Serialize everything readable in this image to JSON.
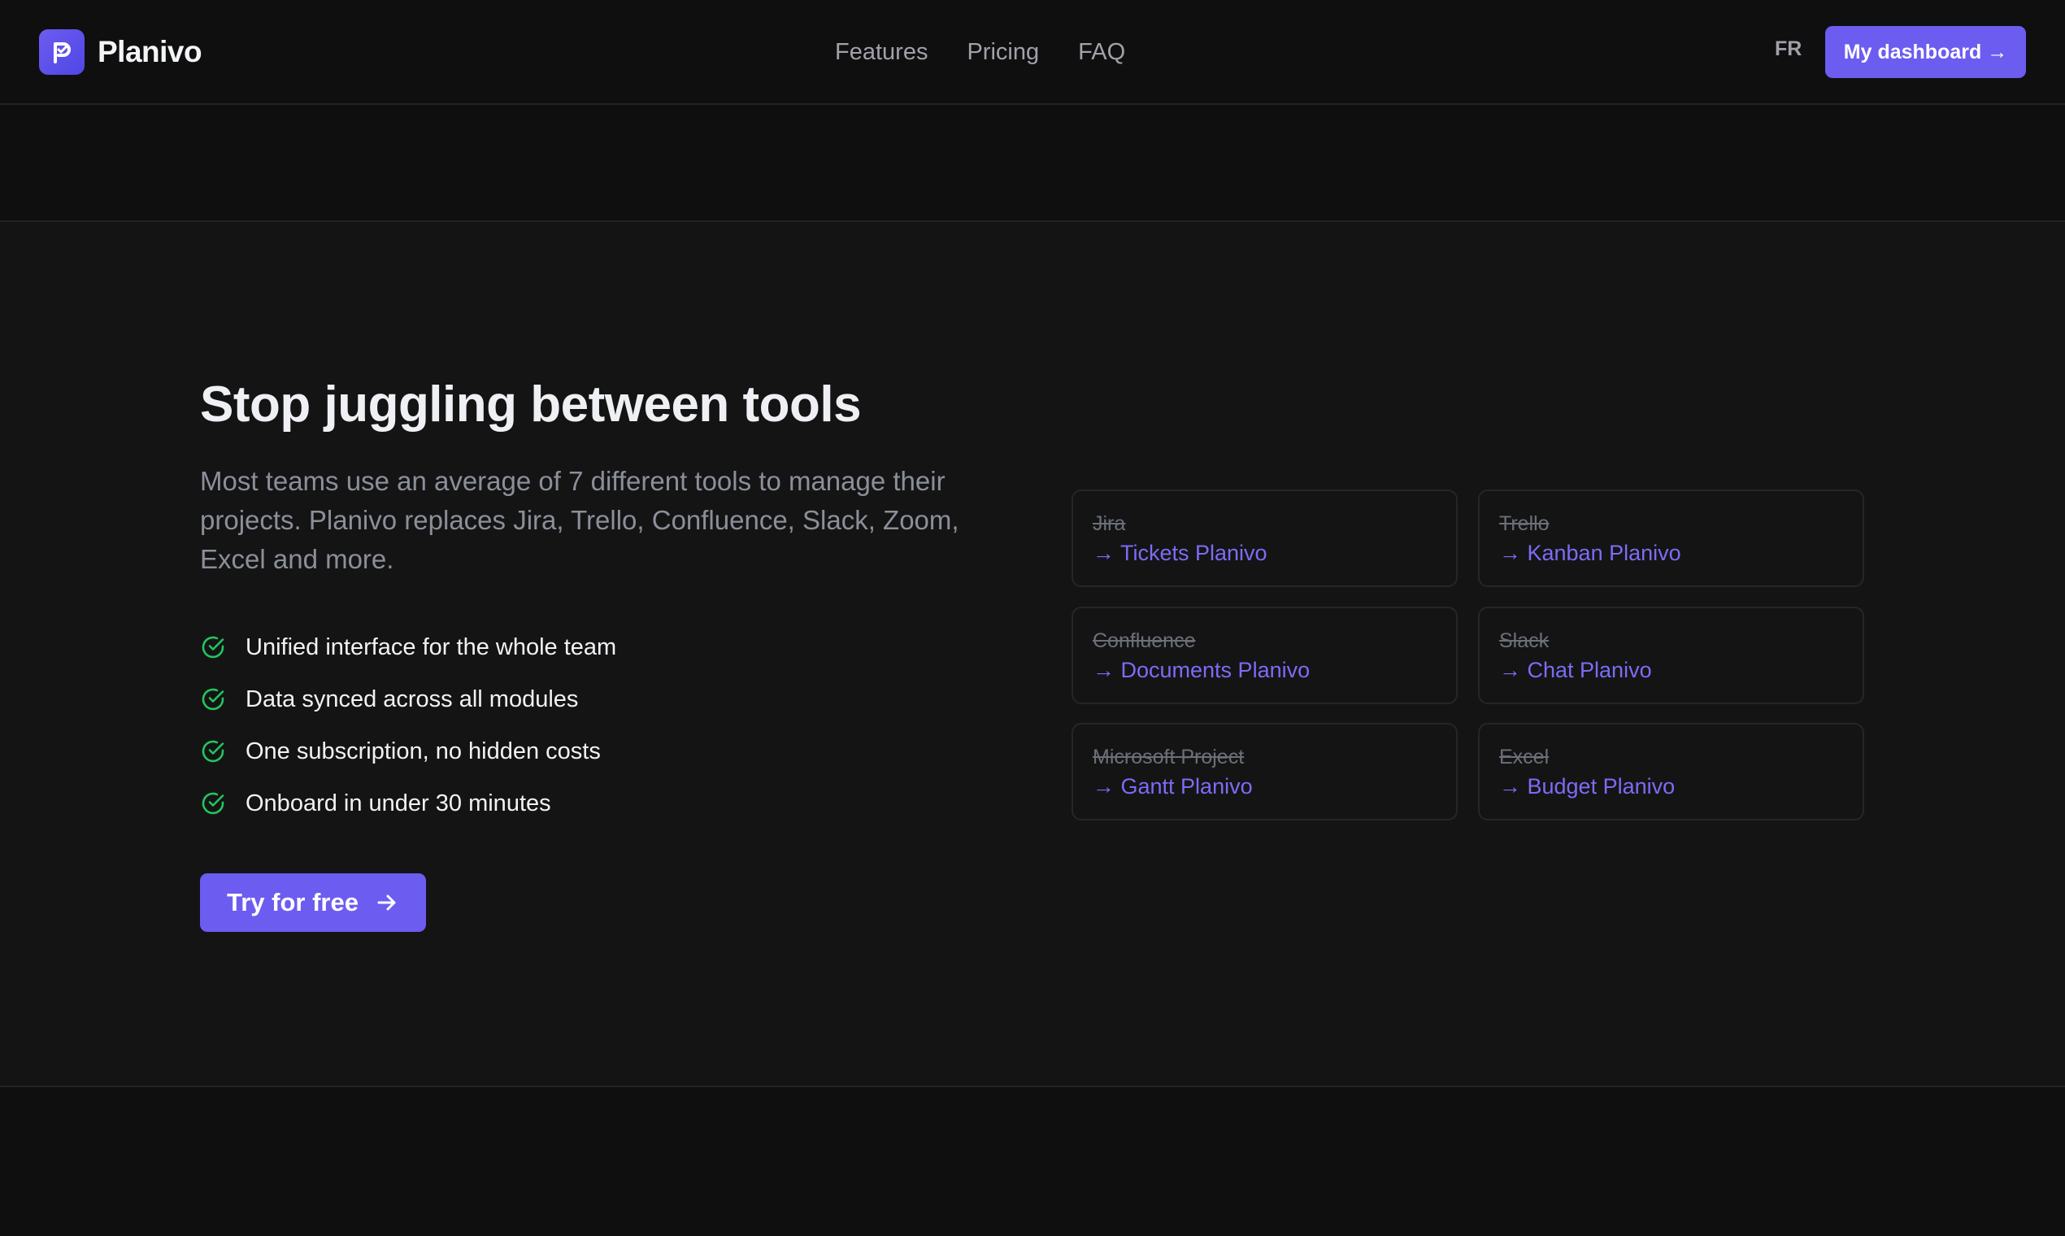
{
  "header": {
    "brand_name": "Planivo",
    "nav": [
      "Features",
      "Pricing",
      "FAQ"
    ],
    "lang": "FR",
    "dashboard_label": "My dashboard →"
  },
  "hero": {
    "title": "Stop juggling between tools",
    "lead": "Most teams use an average of 7 different tools to manage their projects. Planivo replaces Jira, Trello, Confluence, Slack, Zoom, Excel and more.",
    "features": [
      "Unified interface for the whole team",
      "Data synced across all modules",
      "One subscription, no hidden costs",
      "Onboard in under 30 minutes"
    ],
    "cta_label": "Try for free"
  },
  "replacements": [
    {
      "old": "Jira",
      "new": "→ Tickets Planivo"
    },
    {
      "old": "Trello",
      "new": "→ Kanban Planivo"
    },
    {
      "old": "Confluence",
      "new": "→ Documents Planivo"
    },
    {
      "old": "Slack",
      "new": "→ Chat Planivo"
    },
    {
      "old": "Microsoft Project",
      "new": "→ Gantt Planivo"
    },
    {
      "old": "Excel",
      "new": "→ Budget Planivo"
    }
  ],
  "colors": {
    "accent": "#6d5cf0",
    "check": "#22c55e",
    "background": "#0f0f10"
  }
}
